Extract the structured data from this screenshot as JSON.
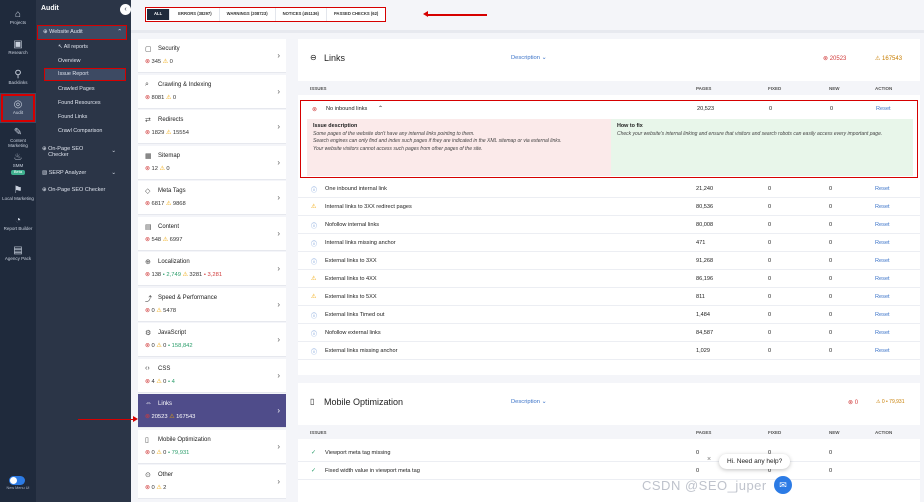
{
  "rail": {
    "items": [
      {
        "label": "Projects",
        "icon": "home-icon"
      },
      {
        "label": "Research",
        "icon": "research-icon"
      },
      {
        "label": "Backlinks",
        "icon": "link-icon"
      },
      {
        "label": "Audit",
        "icon": "audit-icon"
      },
      {
        "label": "Content Marketing",
        "icon": "content-icon"
      },
      {
        "label": "SMM",
        "icon": "smm-icon"
      },
      {
        "label": "Beta",
        "icon": ""
      },
      {
        "label": "Local Marketing",
        "icon": "pin-icon"
      },
      {
        "label": "Report Builder",
        "icon": "report-icon"
      },
      {
        "label": "Agency Pack",
        "icon": "agency-icon"
      }
    ],
    "footer": "New Menu UI"
  },
  "subnav": {
    "title": "Audit",
    "website_audit": "Website Audit",
    "children": [
      "All reports",
      "Overview",
      "Issue Report",
      "Crawled Pages",
      "Found Resources",
      "Found Links",
      "Crawl Comparison"
    ],
    "onpage_seo": "On-Page SEO Checker",
    "serp": "SERP Analyzer",
    "onpage_seo2": "On-Page SEO Checker"
  },
  "filters": [
    "ALL",
    "ERRORS (38297)",
    "WARNINGS (208723)",
    "NOTICES (451136)",
    "PASSED CHECKS (62)"
  ],
  "categories": [
    {
      "name": "Security",
      "err": "345",
      "warn": "0",
      "extra": ""
    },
    {
      "name": "Crawling & Indexing",
      "err": "8081",
      "warn": "0",
      "extra": ""
    },
    {
      "name": "Redirects",
      "err": "1829",
      "warn": "15554",
      "extra": ""
    },
    {
      "name": "Sitemap",
      "err": "12",
      "warn": "0",
      "extra": ""
    },
    {
      "name": "Meta Tags",
      "err": "6817",
      "warn": "9868",
      "extra": ""
    },
    {
      "name": "Content",
      "err": "548",
      "warn": "6997",
      "extra": ""
    },
    {
      "name": "Localization",
      "err": "138",
      "warn": "3281",
      "extra": "• 2,749",
      "extra2": "• 3,281"
    },
    {
      "name": "Speed & Performance",
      "err": "0",
      "warn": "5478",
      "extra": ""
    },
    {
      "name": "JavaScript",
      "err": "0",
      "warn": "0",
      "extra": "• 158,842"
    },
    {
      "name": "CSS",
      "err": "4",
      "warn": "0",
      "extra": "• 4"
    },
    {
      "name": "Links",
      "err": "20523",
      "warn": "167543",
      "extra": ""
    },
    {
      "name": "Mobile Optimization",
      "err": "0",
      "warn": "0",
      "extra": "• 79,931"
    },
    {
      "name": "Other",
      "err": "0",
      "warn": "2",
      "extra": ""
    }
  ],
  "panel": {
    "title": "Links",
    "description": "Description",
    "err_total": "20523",
    "warn_total": "167543",
    "headers": [
      "ISSUES",
      "PAGES",
      "FIXED",
      "NEW",
      "ACTION"
    ],
    "expanded": {
      "name": "No inbound links",
      "pages": "20,523",
      "fixed": "0",
      "new": "0",
      "action": "Reset",
      "issue_h": "Issue description",
      "issue_t1": "Some pages of the website don't have any internal links pointing to them.",
      "issue_t2": "Search engines can only find and index such pages if they are indicated in the XML sitemap or via external links.",
      "issue_t3": "Your website visitors cannot access such pages from other pages of the site.",
      "fix_h": "How to fix",
      "fix_t": "Check your website's internal linking and ensure that visitors and search robots can easily access every important page."
    },
    "rows": [
      {
        "type": "info",
        "name": "One inbound internal link",
        "pages": "21,240",
        "fixed": "0",
        "new": "0",
        "action": "Reset"
      },
      {
        "type": "warn",
        "name": "Internal links to 3XX redirect pages",
        "pages": "80,536",
        "fixed": "0",
        "new": "0",
        "action": "Reset"
      },
      {
        "type": "info",
        "name": "Nofollow internal links",
        "pages": "80,008",
        "fixed": "0",
        "new": "0",
        "action": "Reset"
      },
      {
        "type": "info",
        "name": "Internal links missing anchor",
        "pages": "471",
        "fixed": "0",
        "new": "0",
        "action": "Reset"
      },
      {
        "type": "info",
        "name": "External links to 3XX",
        "pages": "91,268",
        "fixed": "0",
        "new": "0",
        "action": "Reset"
      },
      {
        "type": "warn",
        "name": "External links to 4XX",
        "pages": "86,196",
        "fixed": "0",
        "new": "0",
        "action": "Reset"
      },
      {
        "type": "warn",
        "name": "External links to 5XX",
        "pages": "811",
        "fixed": "0",
        "new": "0",
        "action": "Reset"
      },
      {
        "type": "info",
        "name": "External links Timed out",
        "pages": "1,484",
        "fixed": "0",
        "new": "0",
        "action": "Reset"
      },
      {
        "type": "info",
        "name": "Nofollow external links",
        "pages": "84,587",
        "fixed": "0",
        "new": "0",
        "action": "Reset"
      },
      {
        "type": "info",
        "name": "External links missing anchor",
        "pages": "1,029",
        "fixed": "0",
        "new": "0",
        "action": "Reset"
      }
    ]
  },
  "panel2": {
    "title": "Mobile Optimization",
    "description": "Description",
    "err_total": "0",
    "notice": "0 • 79,931",
    "headers": [
      "ISSUES",
      "PAGES",
      "FIXED",
      "NEW",
      "ACTION"
    ],
    "rows": [
      {
        "name": "Viewport meta tag missing",
        "pages": "0",
        "fixed": "0",
        "new": "0"
      },
      {
        "name": "Fixed width value in viewport meta tag",
        "pages": "0",
        "fixed": "0",
        "new": "0"
      }
    ]
  },
  "help": "Hi. Need any help?",
  "watermark": "CSDN @SEO_juper",
  "colors": {
    "error": "#d13b3b",
    "warning": "#f0a500",
    "highlight": "#d60000",
    "selected": "#4f4c8a"
  }
}
